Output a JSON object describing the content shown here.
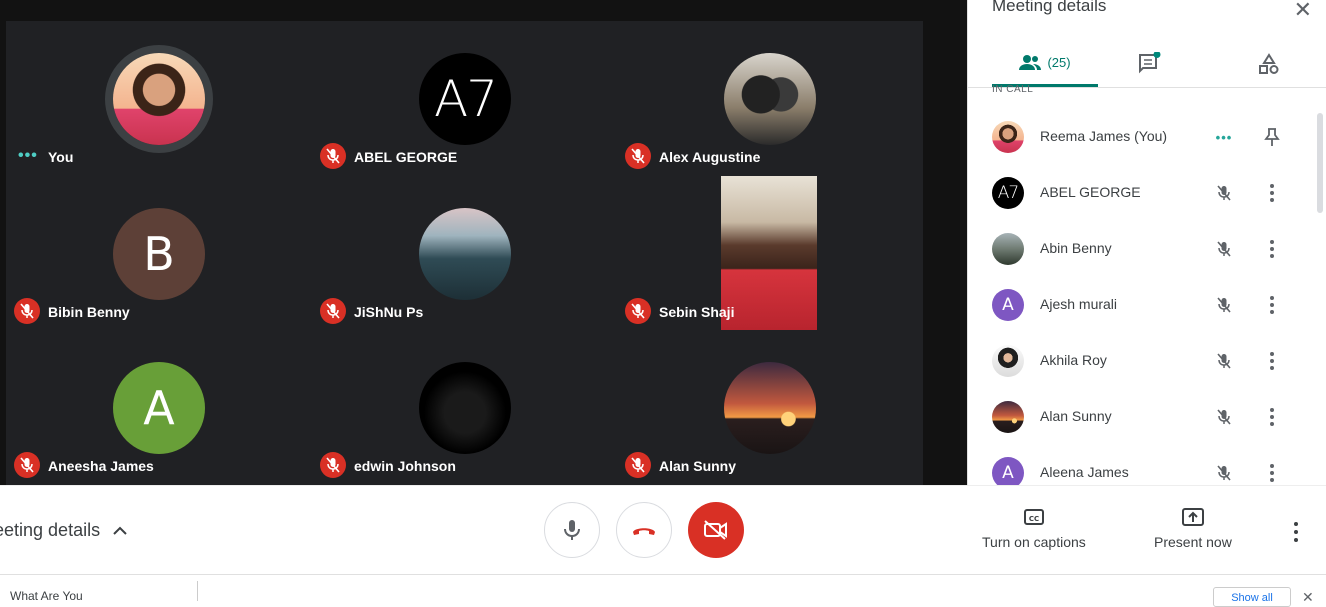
{
  "tiles": [
    {
      "name": "You",
      "avatar": "photo-woman",
      "status": "speaking-dots"
    },
    {
      "name": "ABEL GEORGE",
      "avatar": "A7",
      "status": "muted"
    },
    {
      "name": "Alex Augustine",
      "avatar": "photo-couple",
      "status": "muted"
    },
    {
      "name": "Bibin Benny",
      "avatar": "B",
      "status": "muted",
      "avatar_color": "#5d4037"
    },
    {
      "name": "JiShNu Ps",
      "avatar": "photo-city",
      "status": "muted"
    },
    {
      "name": "Sebin Shaji",
      "avatar": "video",
      "status": "muted"
    },
    {
      "name": "Aneesha James",
      "avatar": "A",
      "status": "muted",
      "avatar_color": "#689f38"
    },
    {
      "name": "edwin Johnson",
      "avatar": "photo-dark",
      "status": "muted"
    },
    {
      "name": "Alan Sunny",
      "avatar": "photo-sunset",
      "status": "muted"
    }
  ],
  "panel": {
    "title": "Meeting details",
    "people_count": "(25)",
    "section_label": "IN CALL",
    "participants": [
      {
        "name": "Reema James (You)",
        "avatar": "photo-woman"
      },
      {
        "name": "ABEL GEORGE",
        "avatar": "A7"
      },
      {
        "name": "Abin Benny",
        "avatar": "photo-landscape"
      },
      {
        "name": "Ajesh murali",
        "avatar": "A",
        "avatar_color": "#7e57c2"
      },
      {
        "name": "Akhila Roy",
        "avatar": "photo-portrait"
      },
      {
        "name": "Alan Sunny",
        "avatar": "photo-sunset"
      },
      {
        "name": "Aleena James",
        "avatar": "A",
        "avatar_color": "#7e57c2"
      }
    ]
  },
  "bottom": {
    "meeting_details": "eeting details",
    "captions_label": "Turn on captions",
    "present_label": "Present now",
    "end_call_color": "#d93025"
  },
  "footer": {
    "left_text": "What Are You",
    "show_all": "Show all"
  }
}
